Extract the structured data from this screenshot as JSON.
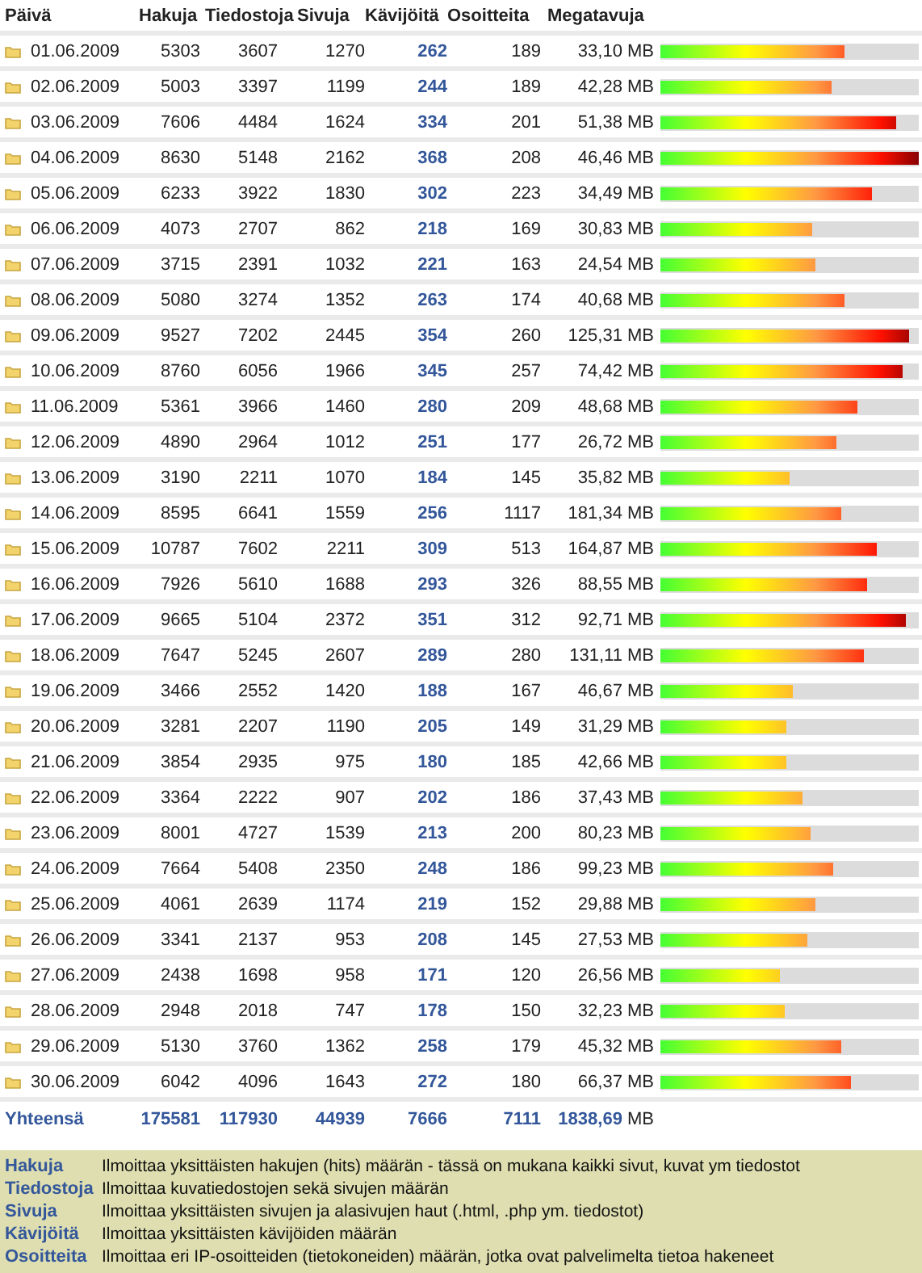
{
  "table": {
    "columns": [
      "Päivä",
      "Hakuja",
      "Tiedostoja",
      "Sivuja",
      "Kävijöitä",
      "Osoitteita",
      "Megatavuja"
    ],
    "rows": [
      {
        "date": "01.06.2009",
        "hakuja": "5303",
        "tiedostoja": "3607",
        "sivuja": "1270",
        "kavijoita": "262",
        "osoitteita": "189",
        "megatavuja": "33,10 MB",
        "level": 0.71
      },
      {
        "date": "02.06.2009",
        "hakuja": "5003",
        "tiedostoja": "3397",
        "sivuja": "1199",
        "kavijoita": "244",
        "osoitteita": "189",
        "megatavuja": "42,28 MB",
        "level": 0.66
      },
      {
        "date": "03.06.2009",
        "hakuja": "7606",
        "tiedostoja": "4484",
        "sivuja": "1624",
        "kavijoita": "334",
        "osoitteita": "201",
        "megatavuja": "51,38 MB",
        "level": 0.91
      },
      {
        "date": "04.06.2009",
        "hakuja": "8630",
        "tiedostoja": "5148",
        "sivuja": "2162",
        "kavijoita": "368",
        "osoitteita": "208",
        "megatavuja": "46,46 MB",
        "level": 1.0
      },
      {
        "date": "05.06.2009",
        "hakuja": "6233",
        "tiedostoja": "3922",
        "sivuja": "1830",
        "kavijoita": "302",
        "osoitteita": "223",
        "megatavuja": "34,49 MB",
        "level": 0.82
      },
      {
        "date": "06.06.2009",
        "hakuja": "4073",
        "tiedostoja": "2707",
        "sivuja": "862",
        "kavijoita": "218",
        "osoitteita": "169",
        "megatavuja": "30,83 MB",
        "level": 0.59
      },
      {
        "date": "07.06.2009",
        "hakuja": "3715",
        "tiedostoja": "2391",
        "sivuja": "1032",
        "kavijoita": "221",
        "osoitteita": "163",
        "megatavuja": "24,54 MB",
        "level": 0.6
      },
      {
        "date": "08.06.2009",
        "hakuja": "5080",
        "tiedostoja": "3274",
        "sivuja": "1352",
        "kavijoita": "263",
        "osoitteita": "174",
        "megatavuja": "40,68 MB",
        "level": 0.71
      },
      {
        "date": "09.06.2009",
        "hakuja": "9527",
        "tiedostoja": "7202",
        "sivuja": "2445",
        "kavijoita": "354",
        "osoitteita": "260",
        "megatavuja": "125,31 MB",
        "level": 0.96
      },
      {
        "date": "10.06.2009",
        "hakuja": "8760",
        "tiedostoja": "6056",
        "sivuja": "1966",
        "kavijoita": "345",
        "osoitteita": "257",
        "megatavuja": "74,42 MB",
        "level": 0.94
      },
      {
        "date": "11.06.2009",
        "hakuja": "5361",
        "tiedostoja": "3966",
        "sivuja": "1460",
        "kavijoita": "280",
        "osoitteita": "209",
        "megatavuja": "48,68 MB",
        "level": 0.76
      },
      {
        "date": "12.06.2009",
        "hakuja": "4890",
        "tiedostoja": "2964",
        "sivuja": "1012",
        "kavijoita": "251",
        "osoitteita": "177",
        "megatavuja": "26,72 MB",
        "level": 0.68
      },
      {
        "date": "13.06.2009",
        "hakuja": "3190",
        "tiedostoja": "2211",
        "sivuja": "1070",
        "kavijoita": "184",
        "osoitteita": "145",
        "megatavuja": "35,82 MB",
        "level": 0.5
      },
      {
        "date": "14.06.2009",
        "hakuja": "8595",
        "tiedostoja": "6641",
        "sivuja": "1559",
        "kavijoita": "256",
        "osoitteita": "1117",
        "megatavuja": "181,34 MB",
        "level": 0.7
      },
      {
        "date": "15.06.2009",
        "hakuja": "10787",
        "tiedostoja": "7602",
        "sivuja": "2211",
        "kavijoita": "309",
        "osoitteita": "513",
        "megatavuja": "164,87 MB",
        "level": 0.84
      },
      {
        "date": "16.06.2009",
        "hakuja": "7926",
        "tiedostoja": "5610",
        "sivuja": "1688",
        "kavijoita": "293",
        "osoitteita": "326",
        "megatavuja": "88,55 MB",
        "level": 0.8
      },
      {
        "date": "17.06.2009",
        "hakuja": "9665",
        "tiedostoja": "5104",
        "sivuja": "2372",
        "kavijoita": "351",
        "osoitteita": "312",
        "megatavuja": "92,71 MB",
        "level": 0.95
      },
      {
        "date": "18.06.2009",
        "hakuja": "7647",
        "tiedostoja": "5245",
        "sivuja": "2607",
        "kavijoita": "289",
        "osoitteita": "280",
        "megatavuja": "131,11 MB",
        "level": 0.79
      },
      {
        "date": "19.06.2009",
        "hakuja": "3466",
        "tiedostoja": "2552",
        "sivuja": "1420",
        "kavijoita": "188",
        "osoitteita": "167",
        "megatavuja": "46,67 MB",
        "level": 0.51
      },
      {
        "date": "20.06.2009",
        "hakuja": "3281",
        "tiedostoja": "2207",
        "sivuja": "1190",
        "kavijoita": "205",
        "osoitteita": "149",
        "megatavuja": "31,29 MB",
        "level": 0.49
      },
      {
        "date": "21.06.2009",
        "hakuja": "3854",
        "tiedostoja": "2935",
        "sivuja": "975",
        "kavijoita": "180",
        "osoitteita": "185",
        "megatavuja": "42,66 MB",
        "level": 0.49
      },
      {
        "date": "22.06.2009",
        "hakuja": "3364",
        "tiedostoja": "2222",
        "sivuja": "907",
        "kavijoita": "202",
        "osoitteita": "186",
        "megatavuja": "37,43 MB",
        "level": 0.55
      },
      {
        "date": "23.06.2009",
        "hakuja": "8001",
        "tiedostoja": "4727",
        "sivuja": "1539",
        "kavijoita": "213",
        "osoitteita": "200",
        "megatavuja": "80,23 MB",
        "level": 0.58
      },
      {
        "date": "24.06.2009",
        "hakuja": "7664",
        "tiedostoja": "5408",
        "sivuja": "2350",
        "kavijoita": "248",
        "osoitteita": "186",
        "megatavuja": "99,23 MB",
        "level": 0.67
      },
      {
        "date": "25.06.2009",
        "hakuja": "4061",
        "tiedostoja": "2639",
        "sivuja": "1174",
        "kavijoita": "219",
        "osoitteita": "152",
        "megatavuja": "29,88 MB",
        "level": 0.6
      },
      {
        "date": "26.06.2009",
        "hakuja": "3341",
        "tiedostoja": "2137",
        "sivuja": "953",
        "kavijoita": "208",
        "osoitteita": "145",
        "megatavuja": "27,53 MB",
        "level": 0.57
      },
      {
        "date": "27.06.2009",
        "hakuja": "2438",
        "tiedostoja": "1698",
        "sivuja": "958",
        "kavijoita": "171",
        "osoitteita": "120",
        "megatavuja": "26,56 MB",
        "level": 0.46
      },
      {
        "date": "28.06.2009",
        "hakuja": "2948",
        "tiedostoja": "2018",
        "sivuja": "747",
        "kavijoita": "178",
        "osoitteita": "150",
        "megatavuja": "32,23 MB",
        "level": 0.48
      },
      {
        "date": "29.06.2009",
        "hakuja": "5130",
        "tiedostoja": "3760",
        "sivuja": "1362",
        "kavijoita": "258",
        "osoitteita": "179",
        "megatavuja": "45,32 MB",
        "level": 0.7
      },
      {
        "date": "30.06.2009",
        "hakuja": "6042",
        "tiedostoja": "4096",
        "sivuja": "1643",
        "kavijoita": "272",
        "osoitteita": "180",
        "megatavuja": "66,37 MB",
        "level": 0.74
      }
    ],
    "totals": {
      "label": "Yhteensä",
      "hakuja": "175581",
      "tiedostoja": "117930",
      "sivuja": "44939",
      "kavijoita": "7666",
      "osoitteita": "7111",
      "megatavuja": "1838,69",
      "unit": "MB"
    }
  },
  "legend": [
    {
      "term": "Hakuja",
      "description": "Ilmoittaa yksittäisten hakujen (hits) määrän - tässä on mukana kaikki sivut, kuvat ym tiedostot"
    },
    {
      "term": "Tiedostoja",
      "description": "Ilmoittaa kuvatiedostojen sekä sivujen määrän"
    },
    {
      "term": "Sivuja",
      "description": "Ilmoittaa yksittäisten sivujen ja alasivujen haut (.html, .php ym. tiedostot)"
    },
    {
      "term": "Kävijöitä",
      "description": "Ilmoittaa yksittäisten kävijöiden määrän"
    },
    {
      "term": "Osoitteita",
      "description": "Ilmoittaa eri IP-osoitteiden (tietokoneiden) määrän, jotka ovat palvelimelta tietoa hakeneet"
    }
  ]
}
